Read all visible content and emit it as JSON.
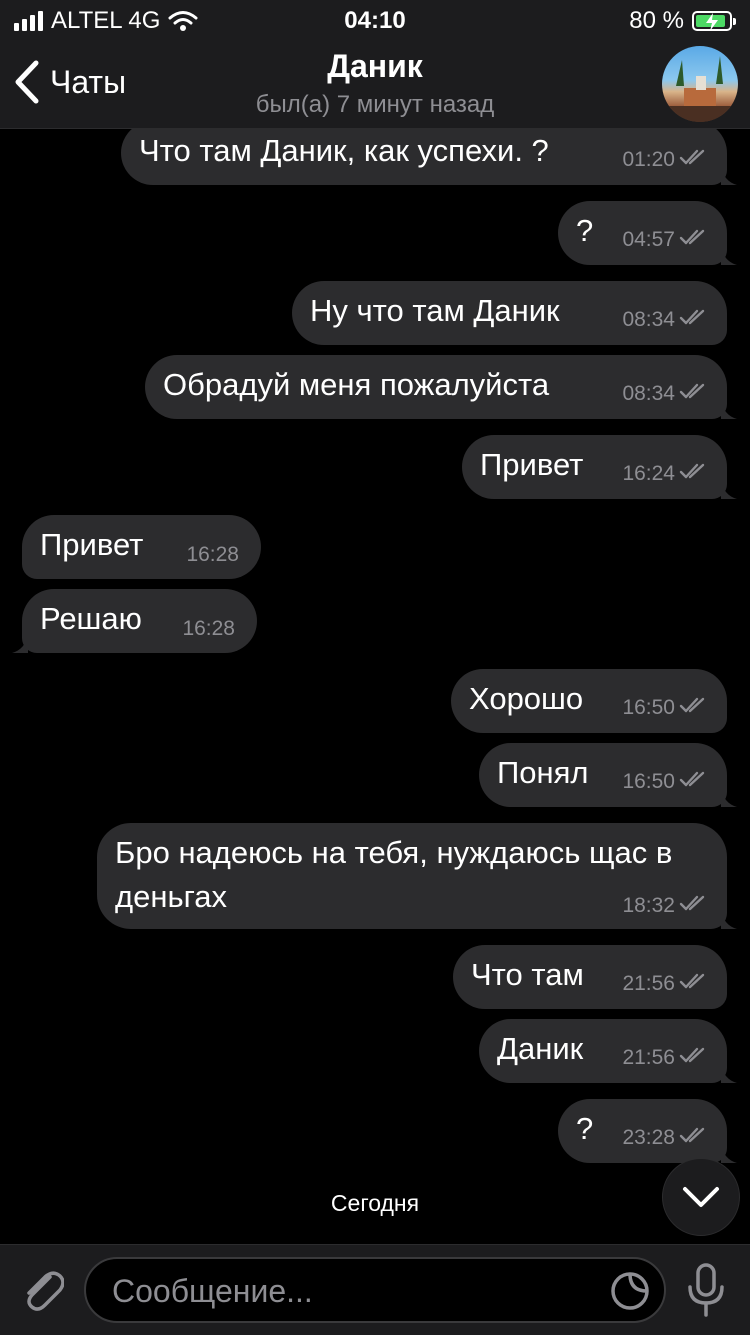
{
  "status_bar": {
    "carrier": "ALTEL 4G",
    "time": "04:10",
    "battery_percent": "80 %",
    "battery_level": 0.8
  },
  "header": {
    "back_label": "Чаты",
    "title": "Даник",
    "subtitle": "был(а) 7 минут назад"
  },
  "messages": [
    {
      "text": "Что там Даник, как успехи. ?",
      "time": "01:20",
      "dir": "out"
    },
    {
      "text": "?",
      "time": "04:57",
      "dir": "out"
    },
    {
      "text": "Ну что там Даник",
      "time": "08:34",
      "dir": "out"
    },
    {
      "text": "Обрадуй меня пожалуйста",
      "time": "08:34",
      "dir": "out"
    },
    {
      "text": "Привет",
      "time": "16:24",
      "dir": "out"
    },
    {
      "text": "Привет",
      "time": "16:28",
      "dir": "in"
    },
    {
      "text": "Решаю",
      "time": "16:28",
      "dir": "in"
    },
    {
      "text": "Хорошо",
      "time": "16:50",
      "dir": "out"
    },
    {
      "text": "Понял",
      "time": "16:50",
      "dir": "out"
    },
    {
      "text": "Бро надеюсь на тебя, нуждаюсь щас в деньгах",
      "time": "18:32",
      "dir": "out"
    },
    {
      "text": "Что там",
      "time": "21:56",
      "dir": "out"
    },
    {
      "text": "Даник",
      "time": "21:56",
      "dir": "out"
    },
    {
      "text": "?",
      "time": "23:28",
      "dir": "out"
    }
  ],
  "date_label": "Сегодня",
  "composer": {
    "placeholder": "Сообщение..."
  },
  "icons": {
    "back": "chevron-left-icon",
    "attach": "paperclip-icon",
    "sticker": "sticker-icon",
    "mic": "microphone-icon",
    "scroll_down": "chevron-down-icon",
    "read_receipt": "double-check-icon"
  },
  "colors": {
    "background": "#000000",
    "bubble": "#2c2c2e",
    "bar": "#1c1c1e",
    "secondary_text": "#8e8e93",
    "battery_fill": "#4cd964"
  }
}
